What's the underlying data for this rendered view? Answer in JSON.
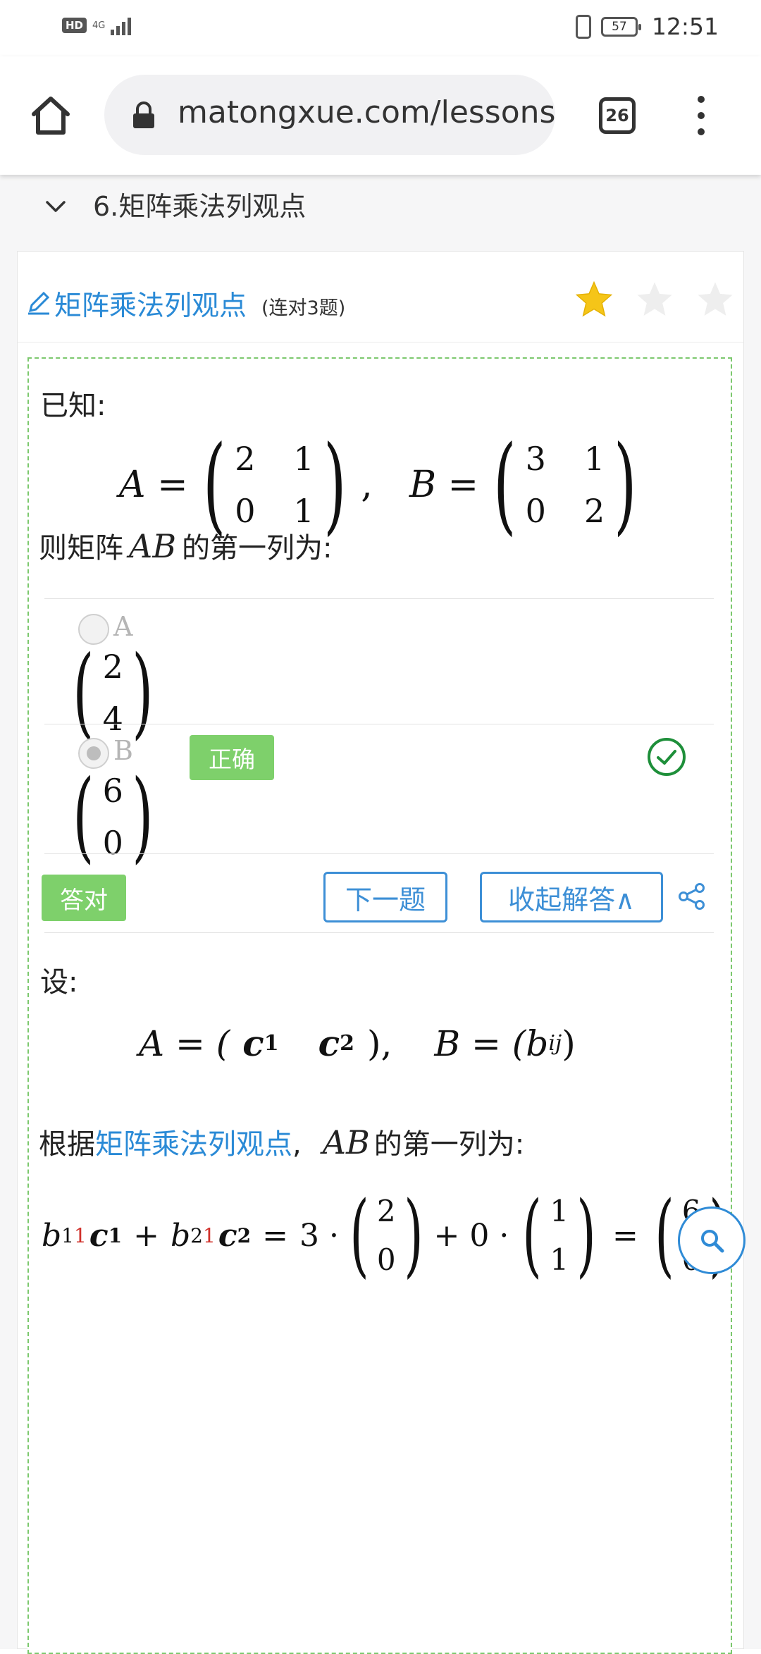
{
  "status_bar": {
    "hd": "HD",
    "network": "4G",
    "battery": "57",
    "time": "12:51"
  },
  "browser": {
    "url": "matongxue.com/lessons",
    "tab_count": "26"
  },
  "lesson": {
    "title": "6.矩阵乘法列观点"
  },
  "card": {
    "title": "矩阵乘法列观点",
    "streak": "(连对3题)",
    "stars_filled": 1,
    "stars_total": 3
  },
  "question": {
    "intro": "已知:",
    "A_label": "A =",
    "A_matrix": [
      [
        "2",
        "1"
      ],
      [
        "0",
        "1"
      ]
    ],
    "B_label": "B =",
    "B_matrix": [
      [
        "3",
        "1"
      ],
      [
        "0",
        "2"
      ]
    ],
    "comma": ",",
    "prompt_prefix": "则矩阵",
    "prompt_var": "AB",
    "prompt_suffix": "的第一列为:"
  },
  "options": [
    {
      "letter": "A",
      "vector": [
        "2",
        "4"
      ],
      "selected": false
    },
    {
      "letter": "B",
      "vector": [
        "6",
        "0"
      ],
      "selected": true,
      "badge": "正确"
    }
  ],
  "actions": {
    "answered_label": "答对",
    "next_label": "下一题",
    "collapse_label": "收起解答∧"
  },
  "solution": {
    "intro": "设:",
    "eq1_A": "A = (",
    "eq1_c1": "c",
    "eq1_c1_sub": "1",
    "eq1_c2": "c",
    "eq1_c2_sub": "2",
    "eq1_close": "),",
    "eq1_B": "B = (b",
    "eq1_B_sub": "ij",
    "eq1_B_close": ")",
    "line2_prefix": "根据",
    "line2_link": "矩阵乘法列观点",
    "line2_comma": ",",
    "line2_var": "AB",
    "line2_suffix": "的第一列为:",
    "eq2": {
      "b1": "b",
      "b1_sub_a": "1",
      "b1_sub_b": "1",
      "c1": "c",
      "c1_sub": "1",
      "plus": "+",
      "b2": "b",
      "b2_sub_a": "2",
      "b2_sub_b": "1",
      "c2": "c",
      "c2_sub": "2",
      "eq": "=",
      "coef1": "3 ·",
      "vec1": [
        "2",
        "0"
      ],
      "plus2": "+ 0 ·",
      "vec2": [
        "1",
        "1"
      ],
      "eq2": "=",
      "vec3": [
        "6",
        "0"
      ]
    }
  },
  "colors": {
    "link_blue": "#2a8ad6",
    "correct_green": "#7ed06b",
    "star_gold": "#f5c518",
    "dashed_border": "#7cc86e"
  }
}
